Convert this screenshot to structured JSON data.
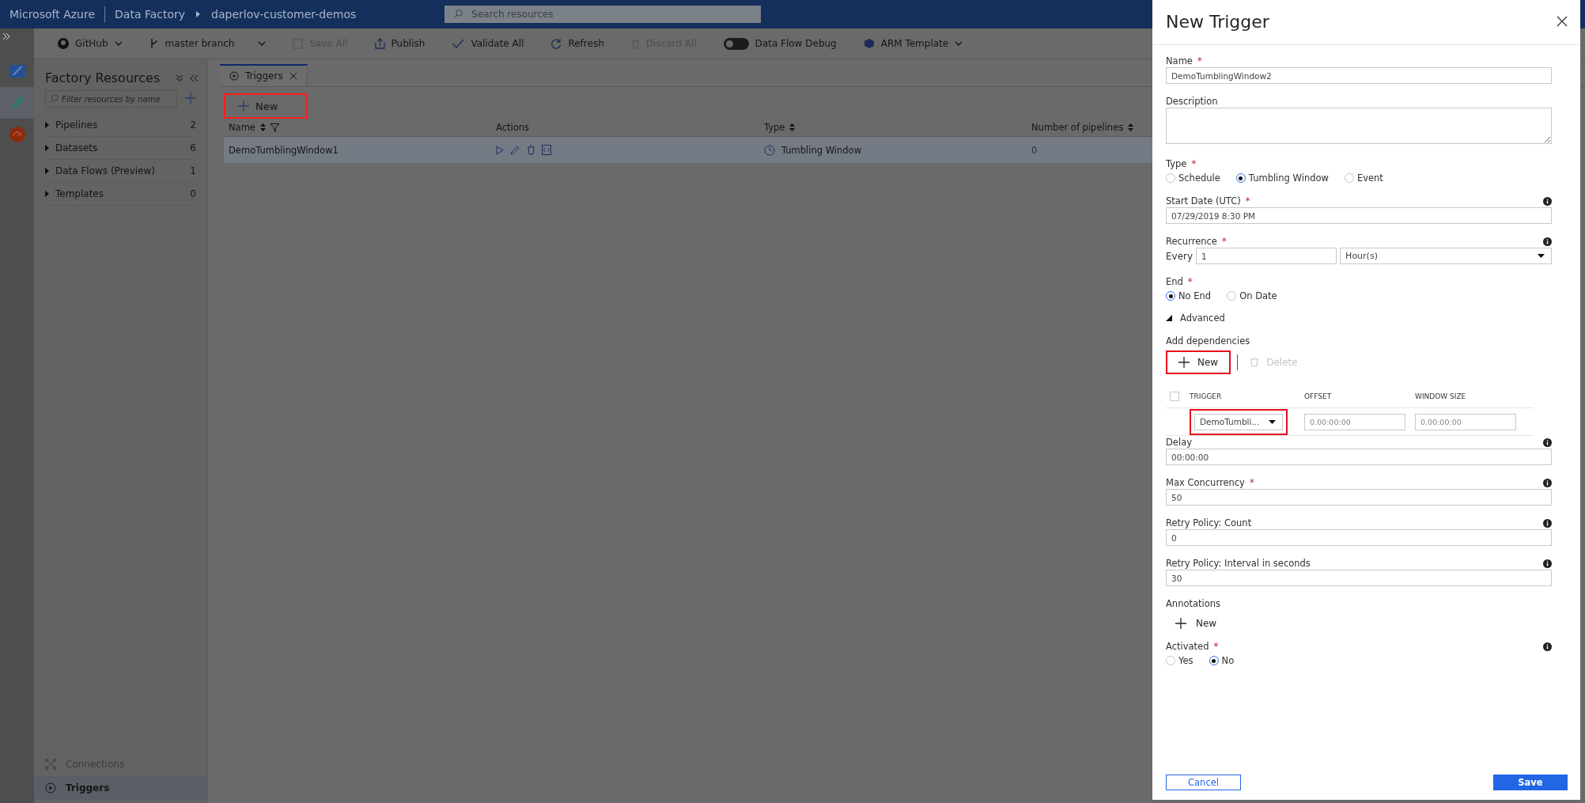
{
  "header": {
    "brand": "Microsoft Azure",
    "service": "Data Factory",
    "factory": "daperlov-customer-demos",
    "search_placeholder": "Search resources"
  },
  "toolbar": [
    {
      "kind": "github",
      "label": "GitHub",
      "disabled": false
    },
    {
      "kind": "branch",
      "label": "master branch",
      "disabled": false
    },
    {
      "kind": "save",
      "label": "Save All",
      "disabled": true
    },
    {
      "kind": "publish",
      "label": "Publish",
      "disabled": false
    },
    {
      "kind": "validate",
      "label": "Validate All",
      "disabled": false
    },
    {
      "kind": "refresh",
      "label": "Refresh",
      "disabled": false
    },
    {
      "kind": "discard",
      "label": "Discard All",
      "disabled": true
    },
    {
      "kind": "toggle",
      "label": "Data Flow Debug",
      "on": false
    },
    {
      "kind": "arm",
      "label": "ARM Template",
      "disabled": false
    }
  ],
  "rail": [
    {
      "kind": "overview",
      "selected": false
    },
    {
      "kind": "author",
      "selected": true
    },
    {
      "kind": "monitor",
      "selected": false
    }
  ],
  "sidebar": {
    "title": "Factory Resources",
    "filter_placeholder": "Filter resources by name",
    "items": [
      {
        "label": "Pipelines",
        "count": "2"
      },
      {
        "label": "Datasets",
        "count": "6"
      },
      {
        "label": "Data Flows (Preview)",
        "count": "1"
      },
      {
        "label": "Templates",
        "count": "0"
      }
    ],
    "bottom": [
      {
        "kind": "connections",
        "label": "Connections",
        "selected": false
      },
      {
        "kind": "triggers",
        "label": "Triggers",
        "selected": true
      }
    ]
  },
  "tabs": [
    {
      "label": "Triggers",
      "selected": true
    }
  ],
  "new_button": {
    "label": "New",
    "highlighted": true
  },
  "table": {
    "columns": [
      {
        "label": "Name",
        "sortable": true,
        "filter": true
      },
      {
        "label": "Actions",
        "sortable": false,
        "filter": false
      },
      {
        "label": "Type",
        "sortable": true,
        "filter": false
      },
      {
        "label": "Number of pipelines",
        "sortable": true,
        "filter": false
      }
    ],
    "rows": [
      {
        "name": "DemoTumblingWindow1",
        "type": "Tumbling Window",
        "pipelines": "0",
        "selected": true
      }
    ]
  },
  "panel": {
    "title": "New Trigger",
    "fields": [
      {
        "kind": "text",
        "label": "Name",
        "required_mark": "*",
        "value": "DemoTumblingWindow2",
        "info": false
      },
      {
        "kind": "textarea",
        "label": "Description",
        "info": false
      },
      {
        "kind": "radio",
        "label": "Type",
        "required_mark": "*",
        "info": false,
        "options": [
          {
            "label": "Schedule",
            "selected": false
          },
          {
            "label": "Tumbling Window",
            "selected": true
          },
          {
            "label": "Event",
            "selected": false
          }
        ]
      },
      {
        "kind": "text",
        "label": "Start Date (UTC)",
        "required_mark": "*",
        "value": "07/29/2019 8:30 PM",
        "info": true
      },
      {
        "kind": "recurrence",
        "label": "Recurrence",
        "required_mark": "*",
        "info": true,
        "every_label": "Every",
        "value": "1",
        "unit": "Hour(s)"
      },
      {
        "kind": "radio",
        "label": "End",
        "required_mark": "*",
        "info": false,
        "options": [
          {
            "label": "No End",
            "selected": true
          },
          {
            "label": "On Date",
            "selected": false
          }
        ]
      },
      {
        "kind": "disclosure",
        "label": "Advanced",
        "expanded": true
      },
      {
        "kind": "dependencies",
        "label": "Add dependencies",
        "new_button": {
          "label": "New",
          "highlighted": true
        },
        "delete_button": {
          "label": "Delete",
          "disabled": true
        },
        "columns": [
          "TRIGGER",
          "OFFSET",
          "WINDOW SIZE"
        ],
        "select_all_checked": false,
        "rows": [
          {
            "trigger": "DemoTumbli...",
            "offset_placeholder": "0.00:00:00",
            "window_size_placeholder": "0.00:00:00",
            "highlighted": true
          }
        ]
      },
      {
        "kind": "text",
        "label": "Delay",
        "value": "00:00:00",
        "info": true
      },
      {
        "kind": "text",
        "label": "Max Concurrency",
        "required_mark": "*",
        "value": "50",
        "info": true
      },
      {
        "kind": "text",
        "label": "Retry Policy: Count",
        "value": "0",
        "info": true
      },
      {
        "kind": "text",
        "label": "Retry Policy: Interval in seconds",
        "value": "30",
        "info": true
      },
      {
        "kind": "annotations",
        "label": "Annotations",
        "new_label": "New"
      },
      {
        "kind": "radio",
        "label": "Activated",
        "required_mark": "*",
        "info": true,
        "options": [
          {
            "label": "Yes",
            "selected": false
          },
          {
            "label": "No",
            "selected": true
          }
        ]
      }
    ],
    "buttons": [
      {
        "kind": "secondary",
        "label": "Cancel"
      },
      {
        "kind": "primary",
        "label": "Save"
      }
    ]
  }
}
